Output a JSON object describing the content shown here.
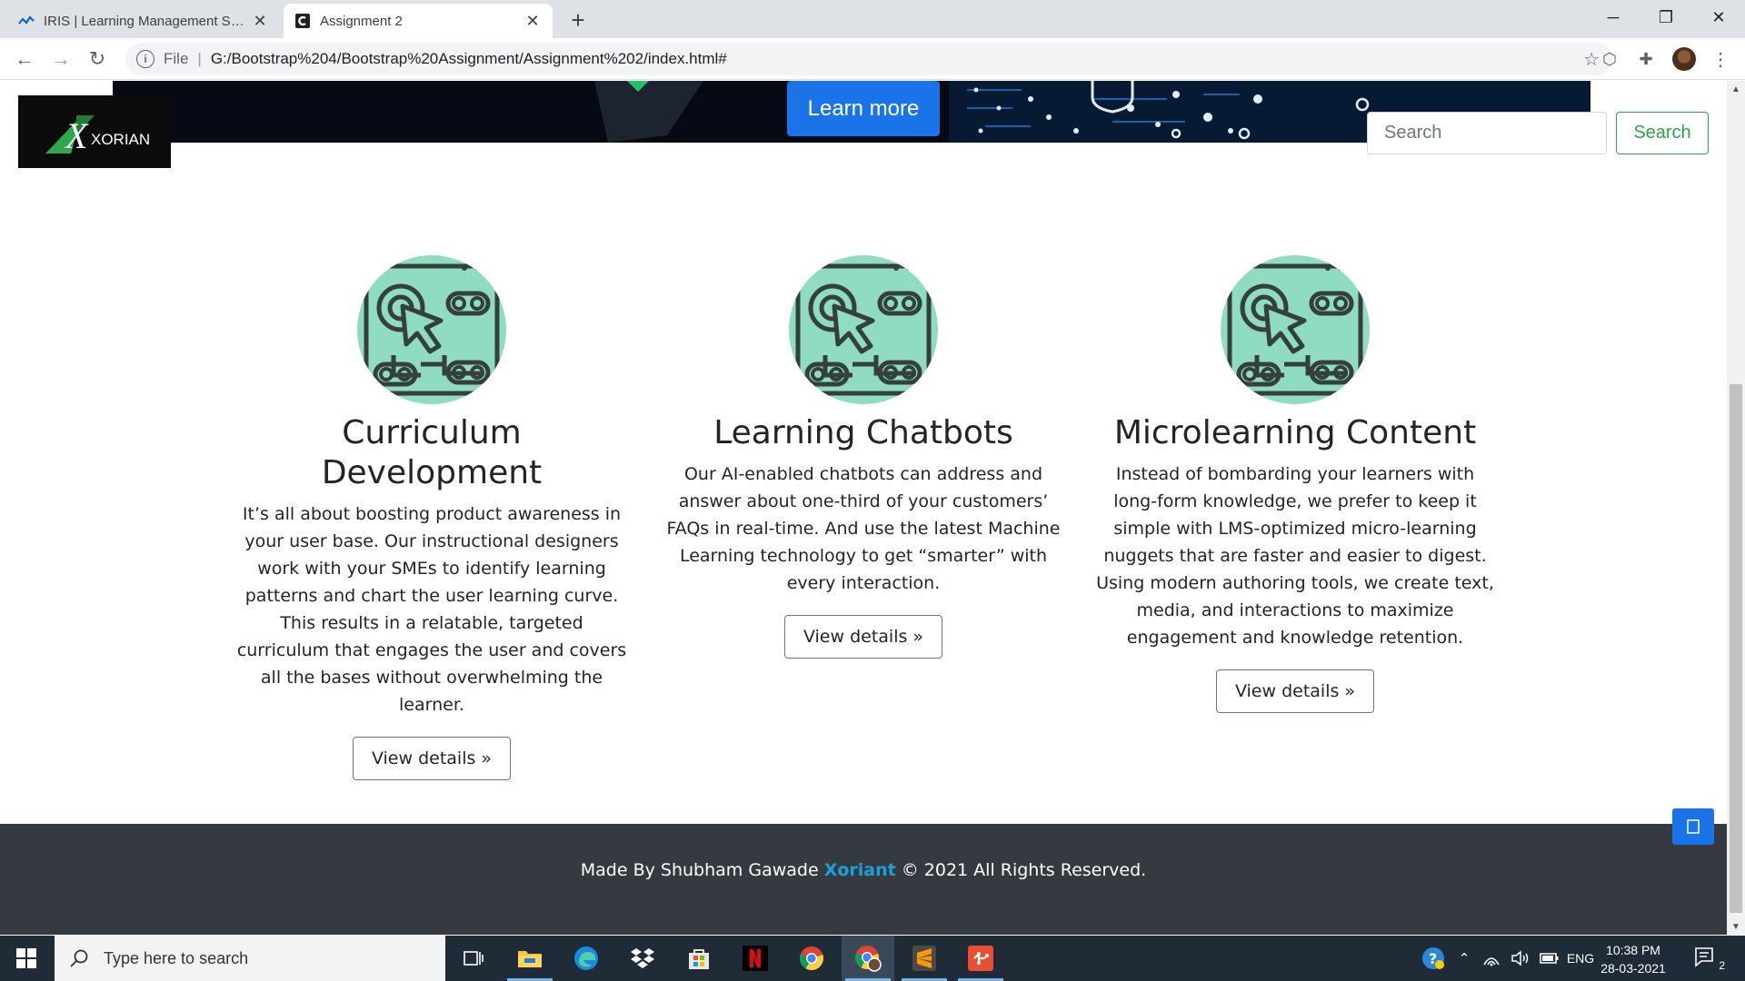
{
  "browser": {
    "tabs": [
      {
        "title": "IRIS | Learning Management System",
        "favicon": "iris-logo-icon",
        "active": false
      },
      {
        "title": "Assignment 2",
        "favicon": "page-c-icon",
        "active": true
      }
    ],
    "address": {
      "scheme_label": "File",
      "url": "G:/Bootstrap%204/Bootstrap%20Assignment/Assignment%202/index.html#"
    }
  },
  "page": {
    "hero": {
      "learn_more_label": "Learn more"
    },
    "brand": {
      "logo_text": "XORIANT"
    },
    "search": {
      "placeholder": "Search",
      "button_label": "Search"
    },
    "features": [
      {
        "icon": "interactive-cursor-icon",
        "title": "Curriculum Development",
        "text": "It’s all about boosting product awareness in your user base. Our instructional designers work with your SMEs to identify learning patterns and chart the user learning curve. This results in a relatable, targeted curriculum that engages the user and covers all the bases without overwhelming the learner.",
        "button_label": "View details »"
      },
      {
        "icon": "interactive-cursor-icon",
        "title": "Learning Chatbots",
        "text": "Our AI-enabled chatbots can address and answer about one-third of your customers’ FAQs in real-time. And use the latest Machine Learning technology to get “smarter” with every interaction.",
        "button_label": "View details »"
      },
      {
        "icon": "interactive-cursor-icon",
        "title": "Microlearning Content",
        "text": "Instead of bombarding your learners with long-form knowledge, we prefer to keep it simple with LMS-optimized micro-learning nuggets that are faster and easier to digest. Using modern authoring tools, we create text, media, and interactions to maximize engagement and knowledge retention.",
        "button_label": "View details »"
      }
    ],
    "footer": {
      "prefix": "Made By Shubham Gawade ",
      "brand": "Xoriant",
      "suffix": " © 2021 All Rights Reserved."
    }
  },
  "taskbar": {
    "search_placeholder": "Type here to search",
    "apps": [
      "task-view-icon",
      "file-explorer-icon",
      "edge-icon",
      "dropbox-icon",
      "store-icon",
      "netflix-icon",
      "chrome-icon",
      "chrome-profile-icon",
      "sublime-text-icon",
      "git-icon"
    ],
    "language": "ENG",
    "time": "10:38 PM",
    "date": "28-03-2021",
    "notification_count": "2"
  },
  "colors": {
    "accent_blue": "#1a73e8",
    "search_green": "#28a745",
    "footer_bg": "#343a40",
    "footer_brand": "#17a2d8",
    "icon_mint": "#8fdcc0"
  }
}
